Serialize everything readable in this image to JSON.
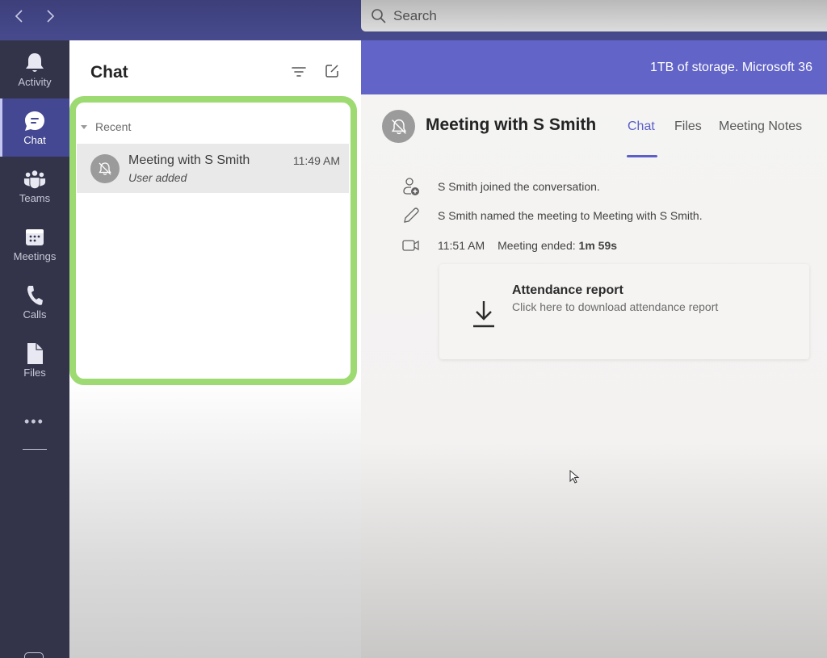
{
  "titlebar": {
    "back_icon": "chevron-left-icon",
    "forward_icon": "chevron-right-icon",
    "search_placeholder": "Search"
  },
  "rail": {
    "items": [
      {
        "label": "Activity",
        "icon": "bell-icon",
        "active": false
      },
      {
        "label": "Chat",
        "icon": "chat-icon",
        "active": true
      },
      {
        "label": "Teams",
        "icon": "teams-icon",
        "active": false
      },
      {
        "label": "Meetings",
        "icon": "calendar-icon",
        "active": false
      },
      {
        "label": "Calls",
        "icon": "phone-icon",
        "active": false
      },
      {
        "label": "Files",
        "icon": "file-icon",
        "active": false
      }
    ],
    "more_label": "•••"
  },
  "chat_list": {
    "title": "Chat",
    "section_label": "Recent",
    "chats": [
      {
        "name": "Meeting with S Smith",
        "time": "11:49 AM",
        "preview": "User added"
      }
    ]
  },
  "main": {
    "banner_text": "1TB of storage. Microsoft 36",
    "meeting_title": "Meeting with S Smith",
    "tabs": [
      {
        "label": "Chat",
        "active": true
      },
      {
        "label": "Files",
        "active": false
      },
      {
        "label": "Meeting Notes",
        "active": false
      }
    ],
    "events": {
      "joined": "S Smith joined the conversation.",
      "renamed": "S Smith named the meeting to Meeting with S Smith.",
      "ended_time": "11:51 AM",
      "ended_label": "Meeting ended: ",
      "ended_duration": "1m 59s"
    },
    "attendance_card": {
      "title": "Attendance report",
      "subtitle": "Click here to download attendance report"
    }
  },
  "colors": {
    "accent": "#5b5fc7",
    "banner": "#6264c7",
    "rail": "#33344a",
    "highlight": "#9ddb72"
  }
}
